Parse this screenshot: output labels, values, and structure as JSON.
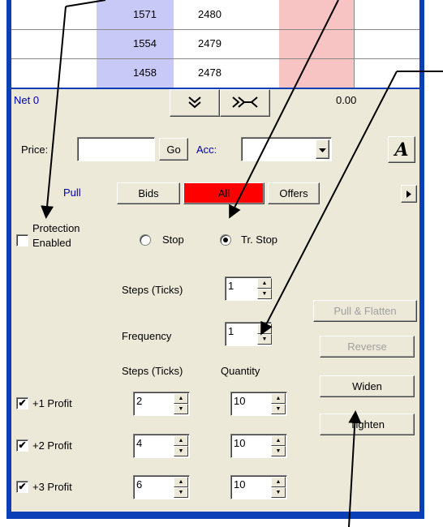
{
  "ladder": {
    "rows": [
      {
        "bid": "1571",
        "price": "2480"
      },
      {
        "bid": "1554",
        "price": "2479"
      },
      {
        "bid": "1458",
        "price": "2478"
      }
    ]
  },
  "netbar": {
    "net_label": "Net 0",
    "pnl": "0.00",
    "down_icon": "double-chevron-down",
    "center_icon": "collapse-arrows"
  },
  "order": {
    "price_label": "Price:",
    "price_value": "",
    "go_label": "Go",
    "acc_label": "Acc:",
    "acc_value": "",
    "font_button": "A"
  },
  "filters": {
    "pull": "Pull",
    "bids": "Bids",
    "all": "All",
    "offers": "Offers",
    "accent_all": "#ff0000"
  },
  "protection": {
    "label_line1": "Protection",
    "label_line2": "Enabled",
    "stop_label": "Stop",
    "trstop_label": "Tr. Stop",
    "selected": "Tr. Stop"
  },
  "settings": {
    "steps_label": "Steps (Ticks)",
    "steps_value": "1",
    "frequency_label": "Frequency",
    "frequency_value": "1"
  },
  "profits": {
    "steps_header": "Steps (Ticks)",
    "quantity_header": "Quantity",
    "rows": [
      {
        "label": "+1 Profit",
        "steps": "2",
        "qty": "10",
        "checked": true
      },
      {
        "label": "+2 Profit",
        "steps": "4",
        "qty": "10",
        "checked": true
      },
      {
        "label": "+3 Profit",
        "steps": "6",
        "qty": "10",
        "checked": true
      }
    ]
  },
  "actions": {
    "pull_flatten": "Pull & Flatten",
    "reverse": "Reverse",
    "widen": "Widen",
    "tighten": "Tighten"
  }
}
